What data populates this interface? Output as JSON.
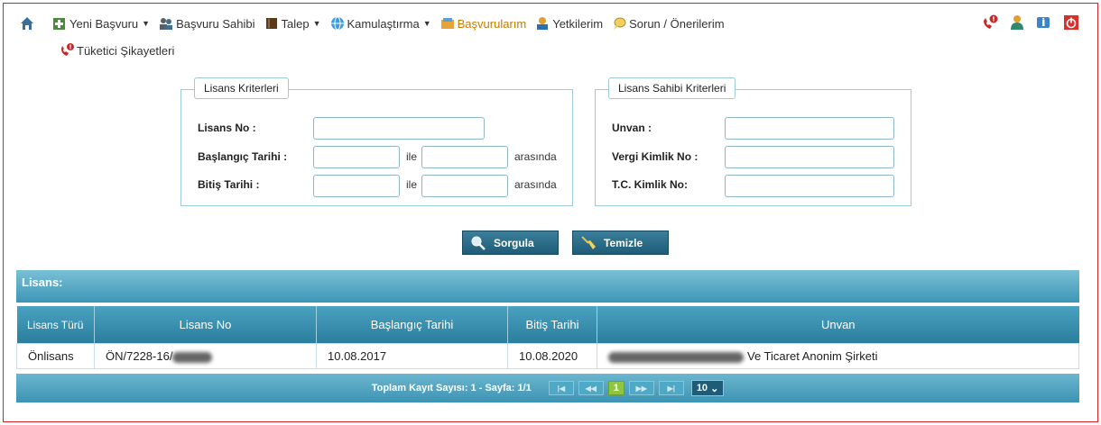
{
  "nav": {
    "items": [
      {
        "label": "Yeni Başvuru",
        "caret": "▼"
      },
      {
        "label": "Başvuru Sahibi",
        "caret": ""
      },
      {
        "label": "Talep",
        "caret": "▼"
      },
      {
        "label": "Kamulaştırma",
        "caret": "▼"
      },
      {
        "label": "Başvurularım",
        "caret": ""
      },
      {
        "label": "Yetkilerim",
        "caret": ""
      },
      {
        "label": "Sorun / Önerilerim",
        "caret": ""
      }
    ],
    "second_row": "Tüketici Şikayetleri"
  },
  "lisans_kriterleri": {
    "legend": "Lisans Kriterleri",
    "lisans_no_label": "Lisans No :",
    "baslangic_label": "Başlangıç Tarihi :",
    "bitis_label": "Bitiş Tarihi :",
    "ile": "ile",
    "arasinda": "arasında"
  },
  "sahibi_kriterleri": {
    "legend": "Lisans Sahibi Kriterleri",
    "unvan_label": "Unvan :",
    "vergi_label": "Vergi Kimlik No :",
    "tc_label": "T.C. Kimlik No:"
  },
  "buttons": {
    "sorgula": "Sorgula",
    "temizle": "Temizle"
  },
  "panel": {
    "title": "Lisans:"
  },
  "table": {
    "headers": [
      "Lisans Türü",
      "Lisans No",
      "Başlangıç Tarihi",
      "Bitiş Tarihi",
      "Unvan"
    ],
    "rows": [
      {
        "tur": "Önlisans",
        "no": "ÖN/7228-16/",
        "baslangic": "10.08.2017",
        "bitis": "10.08.2020",
        "unvan": "Ve Ticaret Anonim Şirketi"
      }
    ]
  },
  "pager": {
    "summary": "Toplam Kayıt Sayısı: 1 - Sayfa: 1/1",
    "current_page": "1",
    "page_size": "10"
  },
  "colors": {
    "accent": "#2b7e9d",
    "border": "#d8222a",
    "active_page": "#8ec63f"
  }
}
